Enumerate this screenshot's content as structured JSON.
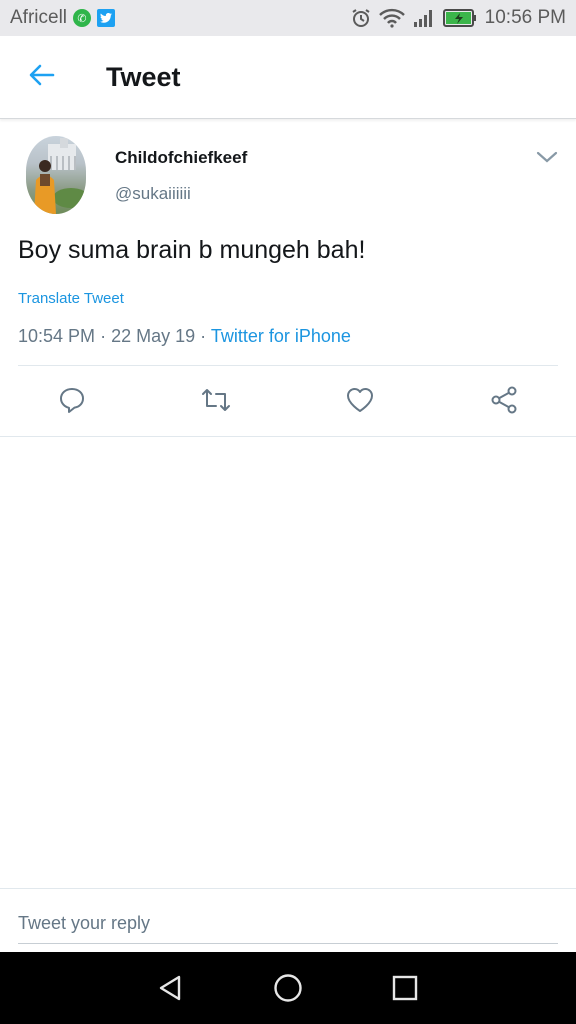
{
  "status_bar": {
    "carrier": "Africell",
    "time": "10:56 PM",
    "icons": [
      "whatsapp-icon",
      "twitter-icon",
      "alarm-icon",
      "wifi-icon",
      "signal-icon",
      "battery-icon"
    ]
  },
  "header": {
    "title": "Tweet",
    "back_icon": "arrow-left-icon"
  },
  "tweet": {
    "display_name": "Childofchiefkeef",
    "handle": "@sukaiiiiii",
    "text": "Boy suma brain b mungeh bah!",
    "translate_label": "Translate Tweet",
    "time": "10:54 PM",
    "date": "22 May 19",
    "separator": "·",
    "source": "Twitter for iPhone"
  },
  "actions": [
    "reply-icon",
    "retweet-icon",
    "like-icon",
    "share-icon"
  ],
  "reply": {
    "placeholder": "Tweet your reply"
  },
  "colors": {
    "accent": "#1da1f2",
    "link": "#1b95e0",
    "secondary_text": "#657786",
    "status_bar_bg": "#e9e9ec"
  }
}
